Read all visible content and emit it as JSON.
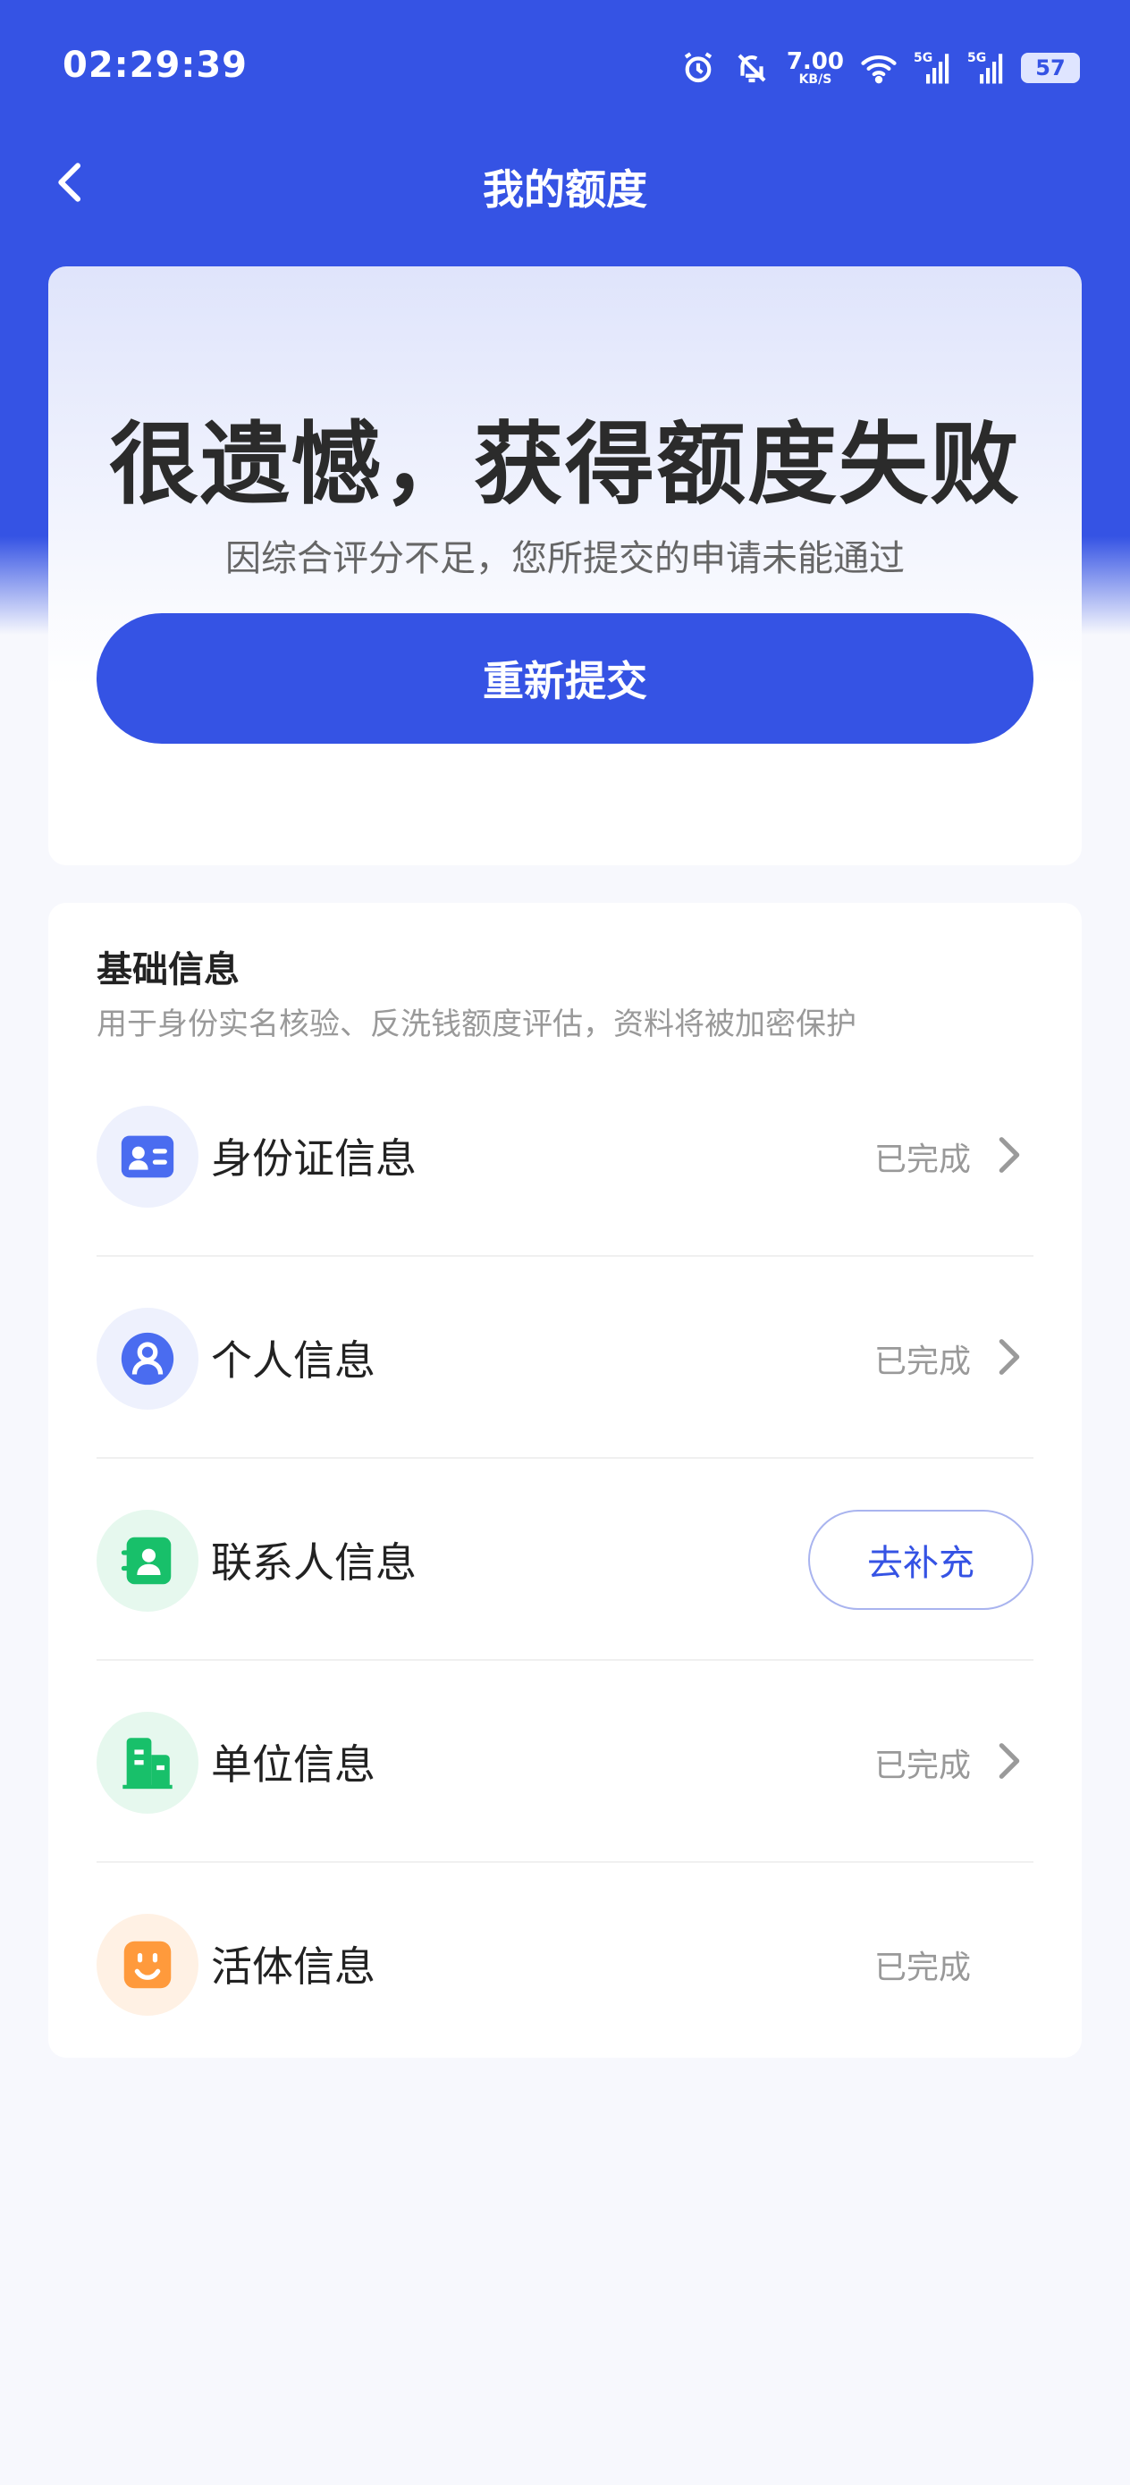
{
  "status_bar": {
    "time": "02:29:39",
    "net_speed_value": "7.00",
    "net_speed_unit": "KB/S",
    "battery": "57",
    "icons": [
      "alarm-icon",
      "mute-icon",
      "wifi-icon",
      "signal-5g-icon",
      "signal-5g-icon",
      "battery-icon"
    ]
  },
  "nav": {
    "title": "我的额度",
    "back_icon": "chevron-left-icon"
  },
  "result": {
    "title": "很遗憾，获得额度失败",
    "subtitle": "因综合评分不足，您所提交的申请未能通过",
    "button": "重新提交"
  },
  "info": {
    "title": "基础信息",
    "desc": "用于身份实名核验、反洗钱额度评估，资料将被加密保护",
    "items": [
      {
        "label": "身份证信息",
        "status": "已完成",
        "icon": "id-card-icon",
        "icon_color": "#4a6cf0"
      },
      {
        "label": "个人信息",
        "status": "已完成",
        "icon": "person-icon",
        "icon_color": "#4a6cf0"
      },
      {
        "label": "联系人信息",
        "action": "去补充",
        "icon": "contact-icon",
        "icon_color": "#18c06a"
      },
      {
        "label": "单位信息",
        "status": "已完成",
        "icon": "building-icon",
        "icon_color": "#18c06a"
      },
      {
        "label": "活体信息",
        "status": "已完成",
        "icon": "face-icon",
        "icon_color": "#ff9a3c"
      }
    ]
  },
  "colors": {
    "primary": "#3553e4",
    "page_bg": "#f7f8fd"
  }
}
